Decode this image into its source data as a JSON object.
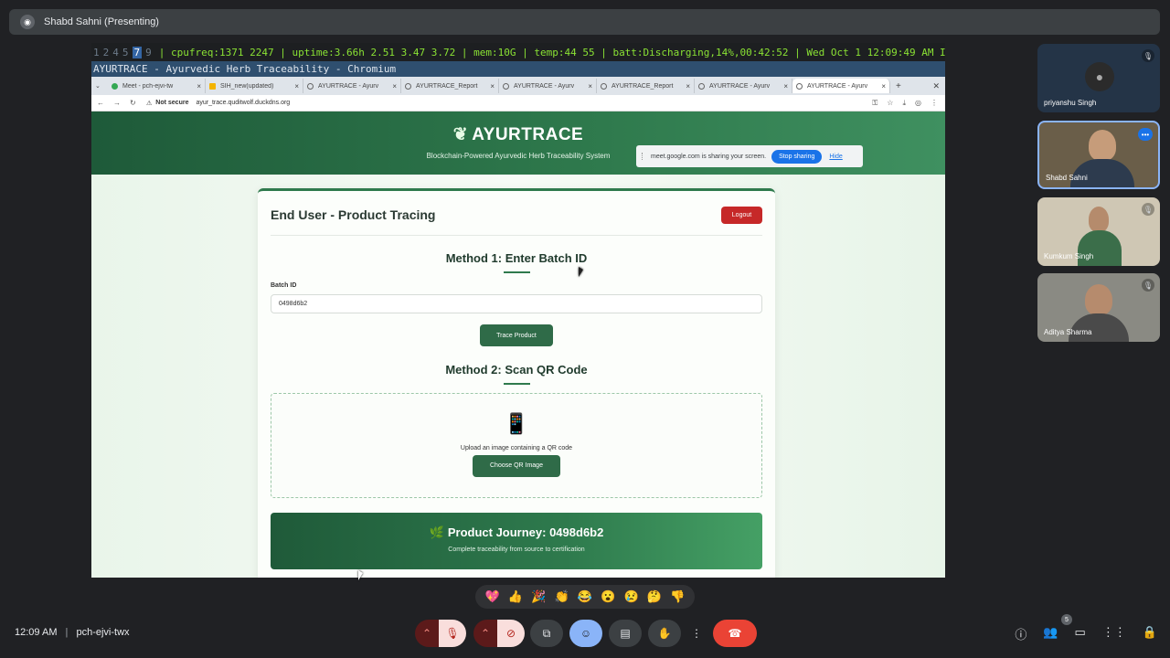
{
  "meet": {
    "presenter": "Shabd Sahni (Presenting)",
    "time": "12:09 AM",
    "separator": "|",
    "meeting_code": "pch-ejvi-twx",
    "people_count": "5",
    "participants": [
      {
        "name": "priyanshu Singh"
      },
      {
        "name": "Shabd Sahni"
      },
      {
        "name": "Kumkum Singh"
      },
      {
        "name": "Aditya Sharma"
      }
    ],
    "reactions": [
      "💖",
      "👍",
      "🎉",
      "👏",
      "😂",
      "😮",
      "😢",
      "🤔",
      "👎"
    ]
  },
  "desktop": {
    "workspaces": [
      "1",
      "2",
      "4",
      "5",
      "7",
      "9"
    ],
    "active_workspace": "7",
    "status": "| cpufreq:1371 2247 | uptime:3.66h 2.51 3.47 3.72 | mem:10G | temp:44 55 | batt:Discharging,14%,00:42:52 | Wed Oct 1 12:09:49 AM IST 2025",
    "window_title": "AYURTRACE - Ayurvedic Herb Traceability - Chromium"
  },
  "browser": {
    "tabs": [
      {
        "label": "Meet - pch-ejvi-tw",
        "icon": "meet"
      },
      {
        "label": "SIH_new(updated)",
        "icon": "doc"
      },
      {
        "label": "AYURTRACE - Ayurv",
        "icon": "globe"
      },
      {
        "label": "AYURTRACE_Report",
        "icon": "globe"
      },
      {
        "label": "AYURTRACE - Ayurv",
        "icon": "globe"
      },
      {
        "label": "AYURTRACE_Report",
        "icon": "globe"
      },
      {
        "label": "AYURTRACE - Ayurv",
        "icon": "globe"
      },
      {
        "label": "AYURTRACE - Ayurv",
        "icon": "globe",
        "active": true
      }
    ],
    "security": "Not secure",
    "url": "ayur_trace.quditwolf.duckdns.org"
  },
  "share_banner": {
    "text": "meet.google.com is sharing your screen.",
    "stop": "Stop sharing",
    "hide": "Hide"
  },
  "app": {
    "brand": "AYURTRACE",
    "tagline": "Blockchain-Powered Ayurvedic Herb Traceability System",
    "heading": "End User - Product Tracing",
    "logout": "Logout",
    "method1": "Method 1: Enter Batch ID",
    "batch_label": "Batch ID",
    "batch_value": "0498d6b2",
    "trace_button": "Trace Product",
    "method2": "Method 2: Scan QR Code",
    "upload_text": "Upload an image containing a QR code",
    "choose_button": "Choose QR Image",
    "journey_title": "Product Journey: 0498d6b2",
    "journey_sub": "Complete traceability from source to certification"
  }
}
